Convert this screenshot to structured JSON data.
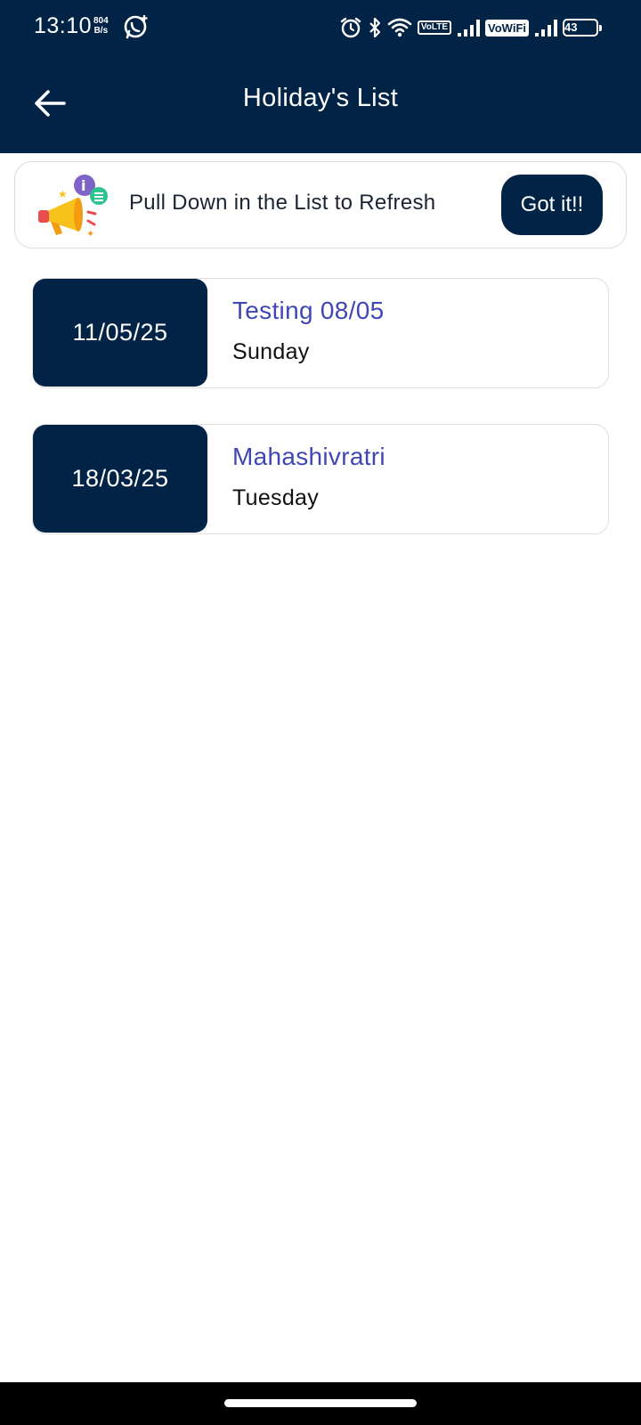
{
  "status_bar": {
    "time": "13:10",
    "net_speed_value": "804",
    "net_speed_unit": "B/s",
    "volte_label_1": "Vo",
    "volte_label_2": "LTE",
    "vowifi_label": "VoWiFi",
    "battery_level": "43"
  },
  "app_bar": {
    "title": "Holiday's List",
    "back_icon": "arrow-left-icon"
  },
  "banner": {
    "text": "Pull Down in the List to Refresh",
    "button_label": "Got it!!",
    "icon": "megaphone-icon"
  },
  "holidays": [
    {
      "date": "11/05/25",
      "name": "Testing 08/05",
      "day": "Sunday"
    },
    {
      "date": "18/03/25",
      "name": "Mahashivratri",
      "day": "Tuesday"
    }
  ],
  "colors": {
    "primary": "#012345",
    "holiday_name": "#4047b3",
    "text": "#111111",
    "card_border": "#dedede"
  }
}
